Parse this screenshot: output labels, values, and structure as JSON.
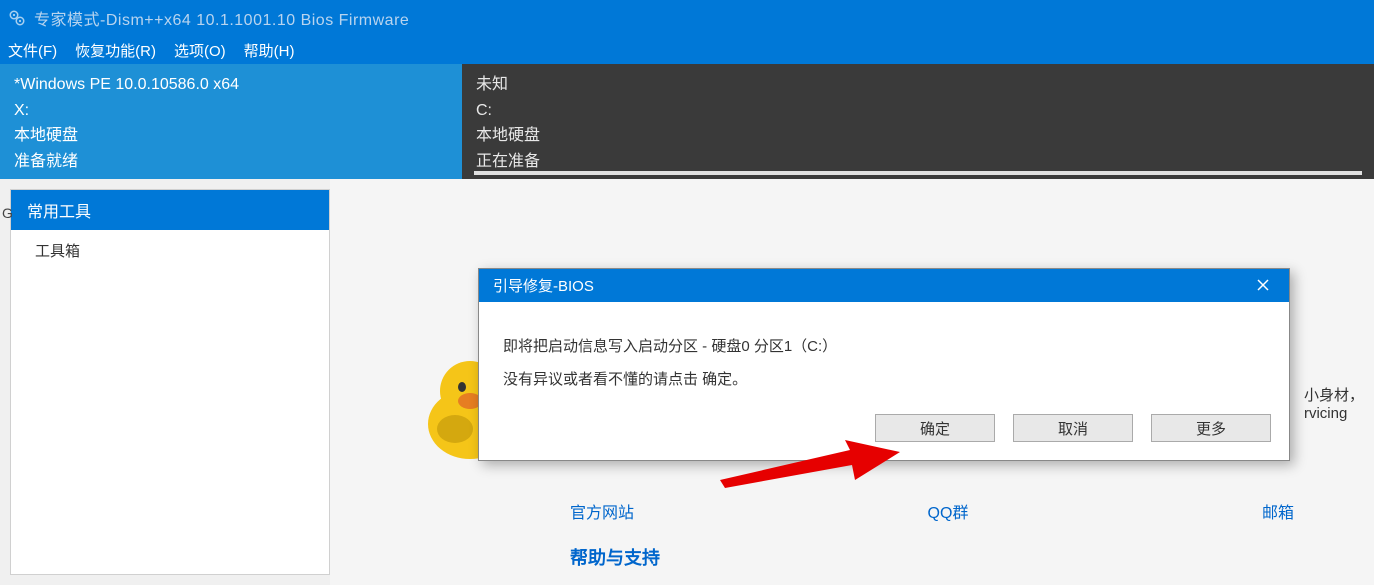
{
  "window": {
    "title": "专家模式-Dism++x64 10.1.1001.10 Bios Firmware"
  },
  "menu": {
    "file": "文件(F)",
    "recovery": "恢复功能(R)",
    "options": "选项(O)",
    "help": "帮助(H)"
  },
  "drive_left": {
    "line1": "*Windows PE 10.0.10586.0 x64",
    "line2": "X:",
    "line3": "本地硬盘",
    "line4": "准备就绪"
  },
  "drive_right": {
    "line1": "未知",
    "line2": "C:",
    "line3": "本地硬盘",
    "line4": "正在准备"
  },
  "sidebar": {
    "header": "常用工具",
    "item1": "工具箱"
  },
  "content": {
    "side_text1": "小身材，",
    "side_text2": "rvicing",
    "link1": "官方网站",
    "link2": "QQ群",
    "link3": "邮箱",
    "help_support": "帮助与支持"
  },
  "dialog": {
    "title": "引导修复-BIOS",
    "message1": "即将把启动信息写入启动分区 - 硬盘0 分区1（C:）",
    "message2": "没有异议或者看不懂的请点击 确定。",
    "btn_ok": "确定",
    "btn_cancel": "取消",
    "btn_more": "更多"
  },
  "edge_letter": "G"
}
